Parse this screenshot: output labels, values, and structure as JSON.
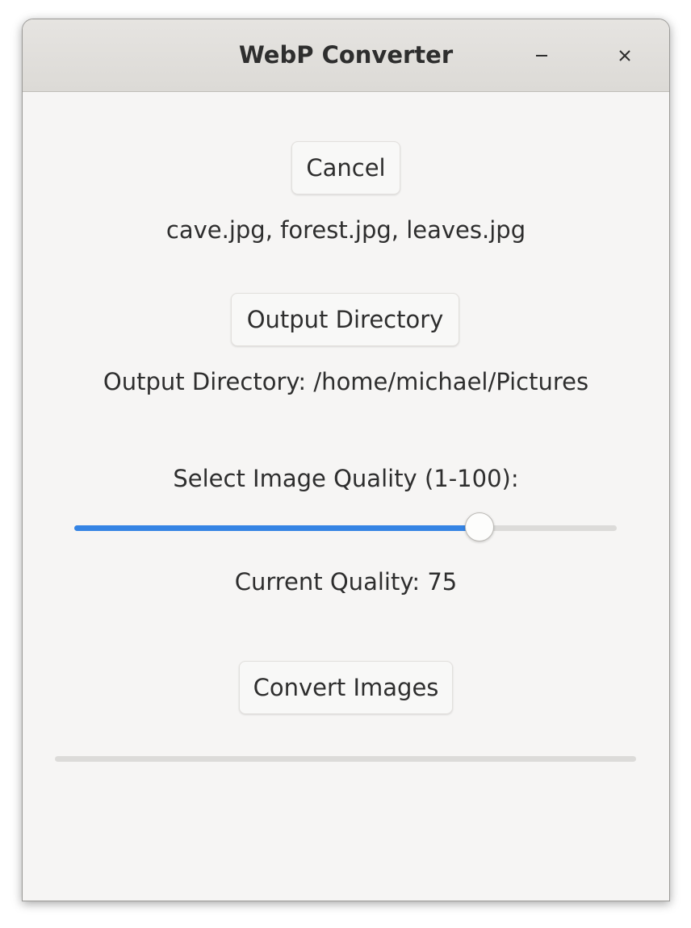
{
  "window": {
    "title": "WebP Converter"
  },
  "icons": {
    "minimize": "minimize-icon",
    "close": "close-icon"
  },
  "cancel_label": "Cancel",
  "selected_files": "cave.jpg, forest.jpg, leaves.jpg",
  "output_dir_button_label": "Output Directory",
  "output_dir_text": "Output Directory: /home/michael/Pictures",
  "quality_prompt": "Select Image Quality (1-100):",
  "quality": {
    "min": 1,
    "max": 100,
    "value": 75
  },
  "current_quality_text": "Current Quality: 75",
  "convert_label": "Convert Images",
  "progress_fraction": 0,
  "colors": {
    "accent": "#3584e4",
    "window_bg": "#f6f5f4",
    "titlebar_bg": "#dedcd9"
  }
}
